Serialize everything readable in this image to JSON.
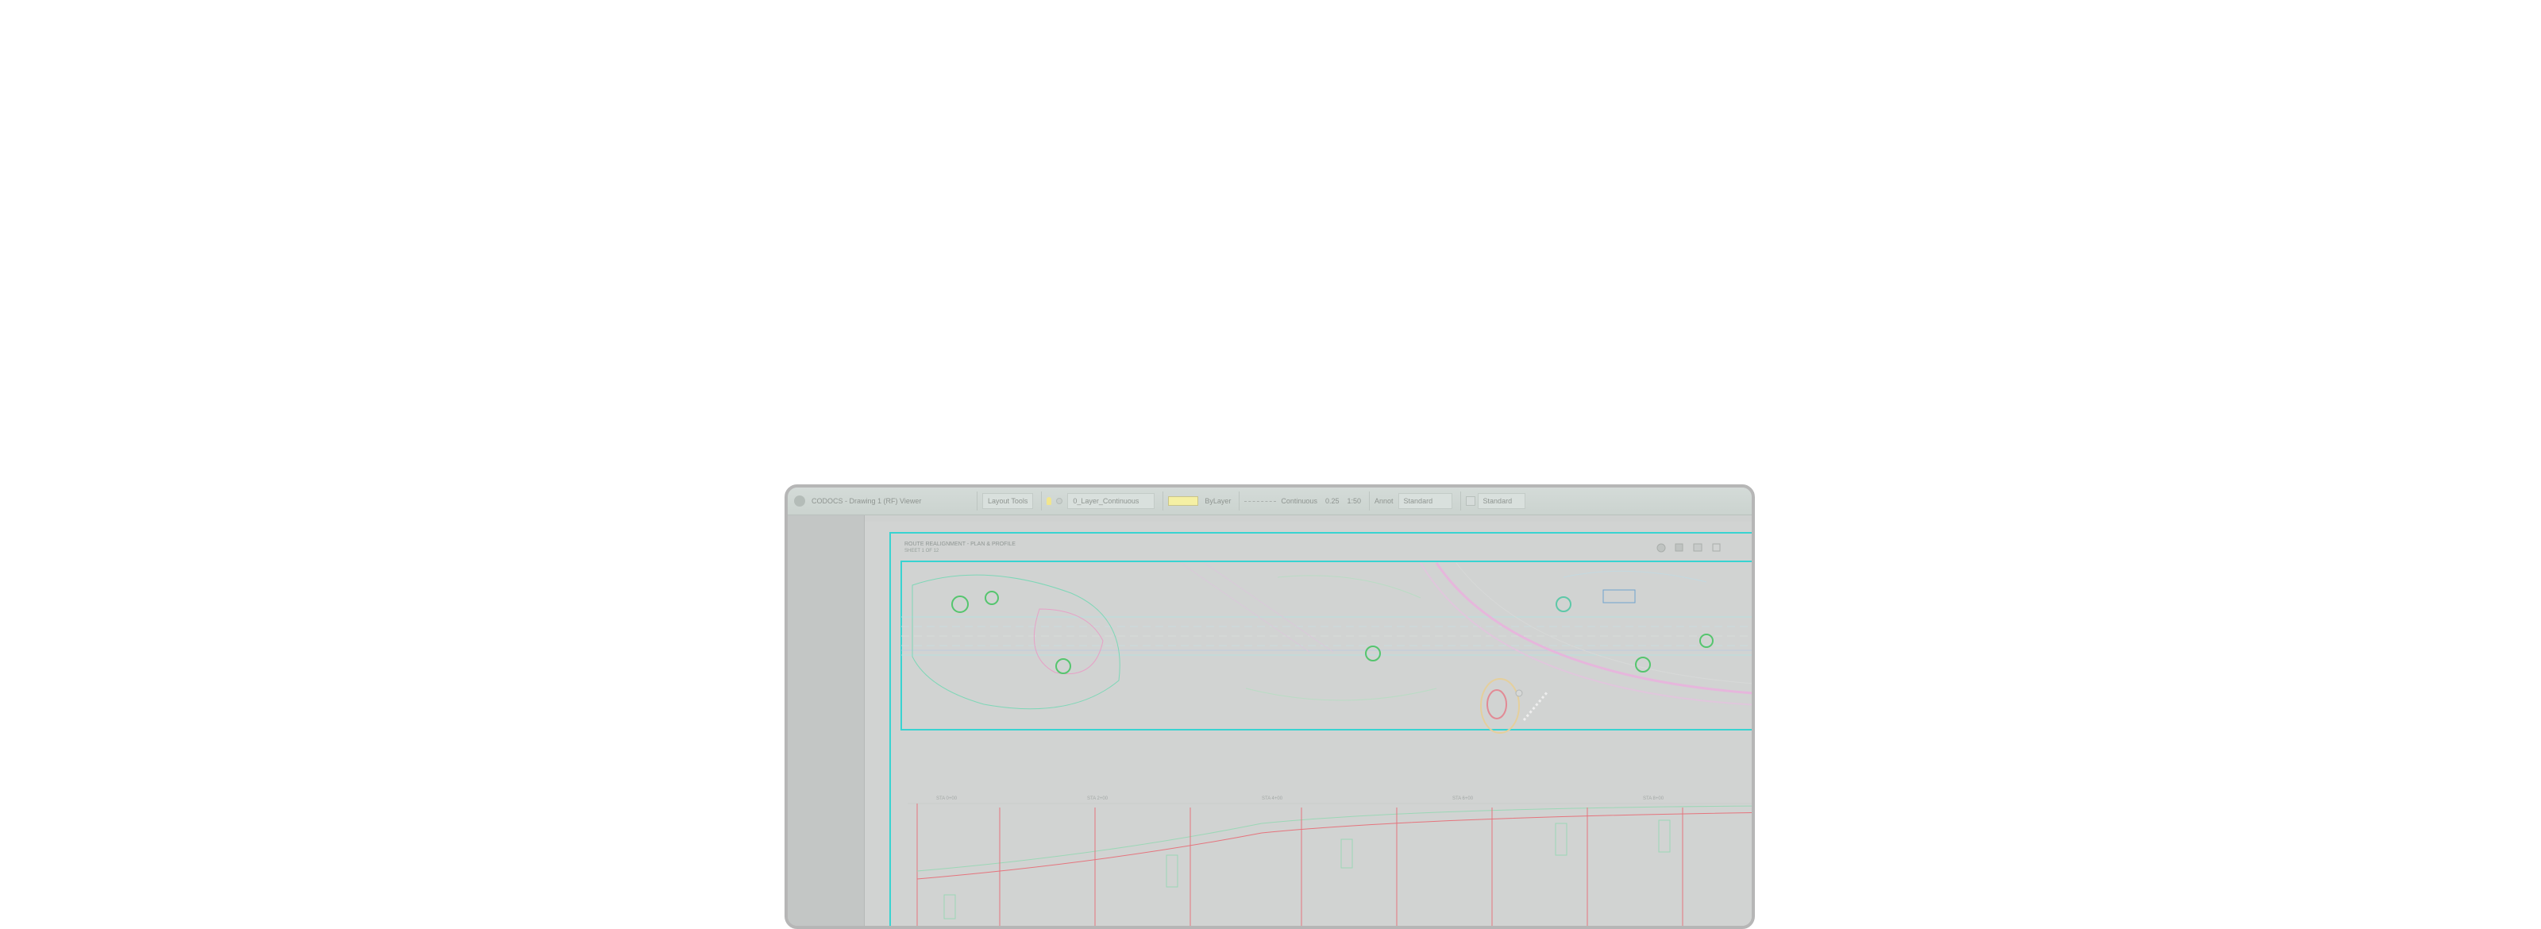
{
  "app": {
    "title": "CODOCS - Drawing 1 (RF) Viewer"
  },
  "toolbar": {
    "view_group_label": "Layout Tools",
    "layer_name": "0_Layer_Continuous",
    "color_label": "ByLayer",
    "color_value": "#f5f0a4",
    "linetype_label": "Continuous",
    "lineweight_value": "0.25",
    "scale_value": "1:50",
    "style_label": "Annot",
    "text_style": "Standard",
    "dim_style": "Standard"
  },
  "drawing": {
    "title_line1": "ROUTE REALIGNMENT - PLAN & PROFILE",
    "title_line2": "SHEET 1 OF 12",
    "view_icons": [
      "zoom-icon",
      "pan-icon",
      "print-icon",
      "menu-icon"
    ],
    "profile_labels": [
      "STA 0+00",
      "STA 2+00",
      "STA 4+00",
      "STA 6+00",
      "STA 8+00"
    ],
    "colors": {
      "frame": "#38d3d1",
      "linework_magenta": "#e58ad5",
      "linework_green": "#39c57b",
      "linework_cyan": "#2fc7d1",
      "profile_red": "#e5747d"
    }
  }
}
